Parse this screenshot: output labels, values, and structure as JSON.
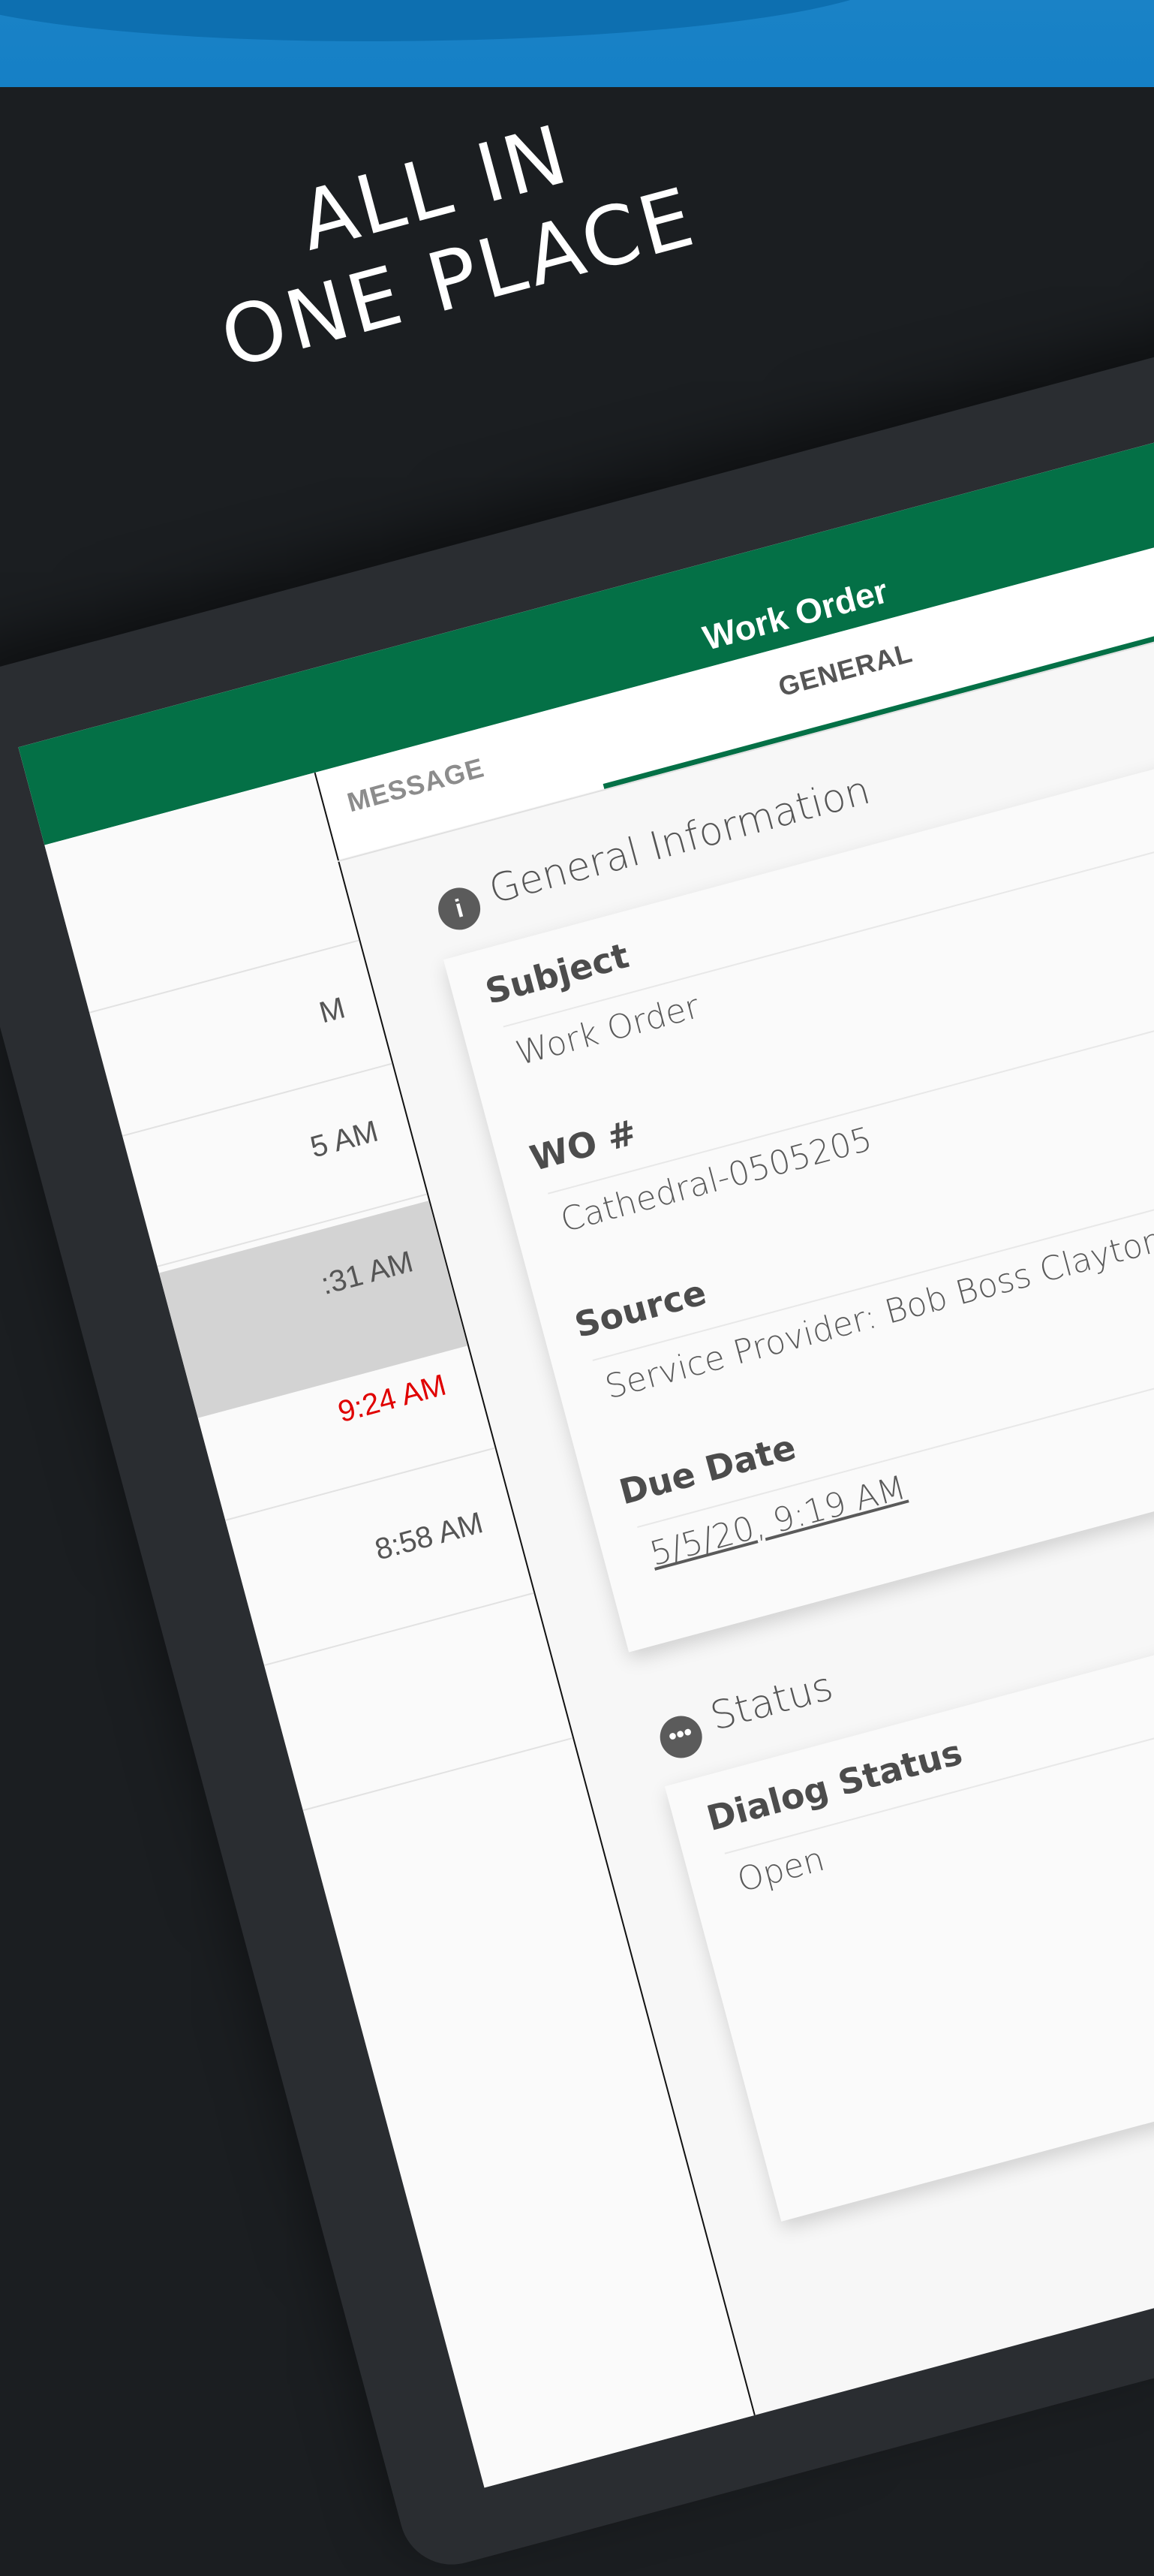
{
  "headline": [
    "ALL IN",
    "ONE PLACE"
  ],
  "app": {
    "title": "Work Order",
    "tabs": [
      {
        "label": "MESSAGE",
        "active": false
      },
      {
        "label": "GENERAL",
        "active": true
      }
    ]
  },
  "list": {
    "times": [
      "M",
      "5 AM",
      ":31 AM",
      "9:24 AM",
      "8:58 AM"
    ],
    "highlight_color": "#e00000"
  },
  "general_info": {
    "heading": "General Information",
    "icon": "info-icon",
    "fields": [
      {
        "label": "Subject",
        "value": "Work Order"
      },
      {
        "label": "WO #",
        "value": "Cathedral-0505205"
      },
      {
        "label": "Source",
        "value": "Service Provider: Bob Boss Clayton"
      },
      {
        "label": "Due Date",
        "value": "5/5/20, 9:19 AM"
      }
    ]
  },
  "status": {
    "heading": "Status",
    "icon": "chat-bubble-icon",
    "fields": [
      {
        "label": "Dialog Status",
        "value": "Open"
      }
    ]
  },
  "colors": {
    "brand_green": "#047046",
    "top_blue": "#1a82c6",
    "accent_green": "#5ccd92",
    "background": "#1b1e21"
  }
}
